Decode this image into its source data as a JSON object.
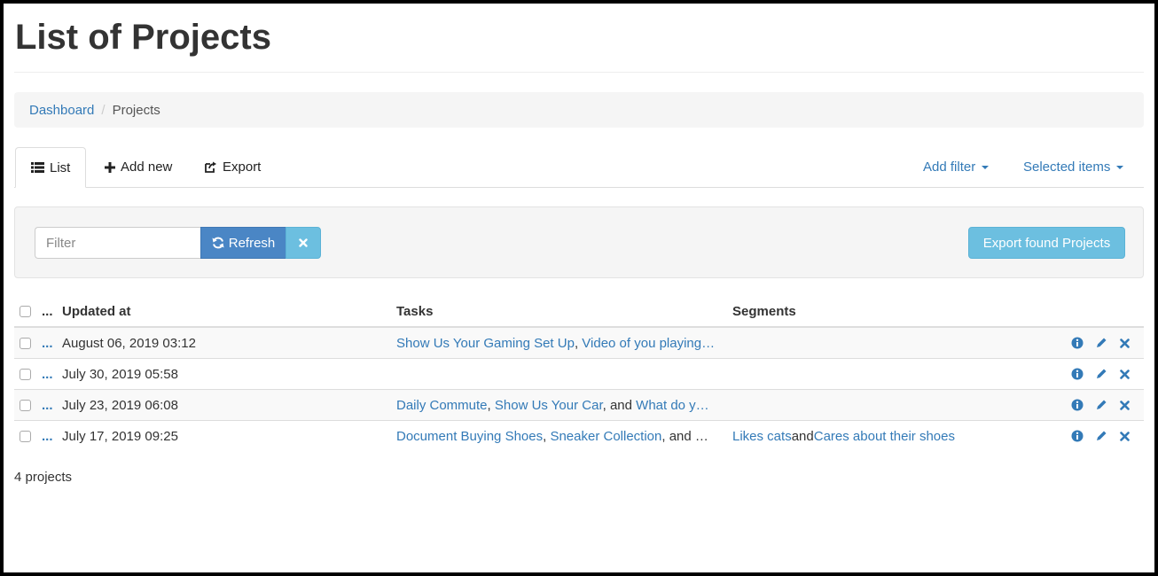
{
  "page": {
    "title": "List of Projects"
  },
  "breadcrumb": {
    "home": "Dashboard",
    "separator": "/",
    "current": "Projects"
  },
  "tabs": {
    "list": {
      "label": "List",
      "icon": "list-icon"
    },
    "add_new": {
      "label": "Add new",
      "icon": "plus-icon"
    },
    "export": {
      "label": "Export",
      "icon": "share-icon"
    }
  },
  "dropdowns": {
    "add_filter": "Add filter",
    "selected_items": "Selected items"
  },
  "filter": {
    "placeholder": "Filter",
    "value": "",
    "refresh_label": "Refresh",
    "export_label": "Export found Projects"
  },
  "table": {
    "headers": {
      "dots": "...",
      "updated_at": "Updated at",
      "tasks": "Tasks",
      "segments": "Segments"
    },
    "rows": [
      {
        "dots": "...",
        "updated_at": "August 06, 2019 03:12",
        "tasks": {
          "a": "Show Us Your Gaming Set Up",
          "s1": ", ",
          "b": "Video of you playing…",
          "s2": "",
          "c": ""
        },
        "segments": {
          "a": "",
          "s": "",
          "b": ""
        }
      },
      {
        "dots": "...",
        "updated_at": "July 30, 2019 05:58",
        "tasks": {
          "a": "",
          "s1": "",
          "b": "",
          "s2": "",
          "c": ""
        },
        "segments": {
          "a": "",
          "s": "",
          "b": ""
        }
      },
      {
        "dots": "...",
        "updated_at": "July 23, 2019 06:08",
        "tasks": {
          "a": "Daily Commute",
          "s1": ", ",
          "b": "Show Us Your Car",
          "s2": ", and ",
          "c": "What do y…"
        },
        "segments": {
          "a": "",
          "s": "",
          "b": ""
        }
      },
      {
        "dots": "...",
        "updated_at": "July 17, 2019 09:25",
        "tasks": {
          "a": "Document Buying Shoes",
          "s1": ", ",
          "b": "Sneaker Collection",
          "s2": ", and …",
          "c": ""
        },
        "segments": {
          "a": "Likes cats",
          "s": " and ",
          "b": "Cares about their shoes"
        }
      }
    ],
    "row_action_icons": [
      "info-icon",
      "pencil-icon",
      "close-icon"
    ]
  },
  "footer": {
    "count": "4 projects"
  },
  "colors": {
    "link": "#337ab7",
    "refresh": "#4a86c5",
    "info_button": "#6cbfe0"
  }
}
